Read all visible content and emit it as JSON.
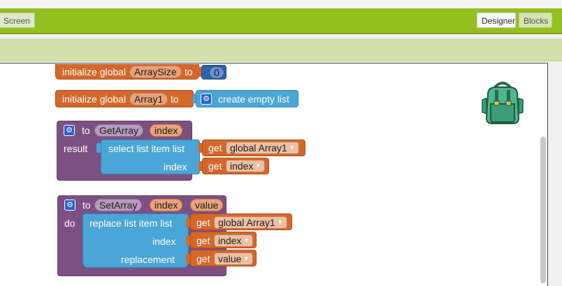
{
  "toolbar": {
    "screen_label": "Screen",
    "designer_label": "Designer",
    "blocks_label": "Blocks"
  },
  "blocks": {
    "array_size": {
      "prefix": "initialize global",
      "name": "ArraySize",
      "to": "to",
      "value": "0"
    },
    "array1": {
      "prefix": "initialize global",
      "name": "Array1",
      "to": "to",
      "create": "create empty list"
    },
    "get_array": {
      "to": "to",
      "name": "GetArray",
      "param": "index",
      "result": "result",
      "select": "select list item  list",
      "get1": "get",
      "var1": "global Array1",
      "index_label": "index",
      "get2": "get",
      "var2": "index"
    },
    "set_array": {
      "to": "to",
      "name": "SetArray",
      "param1": "index",
      "param2": "value",
      "do": "do",
      "replace": "replace list item  list",
      "get1": "get",
      "var1": "global Array1",
      "index_label": "index",
      "get2": "get",
      "var2": "index",
      "replacement_label": "replacement",
      "get3": "get",
      "var3": "value"
    }
  },
  "icons": {
    "backpack": "backpack-icon",
    "gear": "gear-icon",
    "dropdown": "dropdown-arrow-icon"
  },
  "colors": {
    "toolbar": "#93c01f",
    "variable_block": "#d4682a",
    "list_block": "#4aa6d6",
    "procedure_block": "#7d5083",
    "number_block": "#2f62ab"
  }
}
